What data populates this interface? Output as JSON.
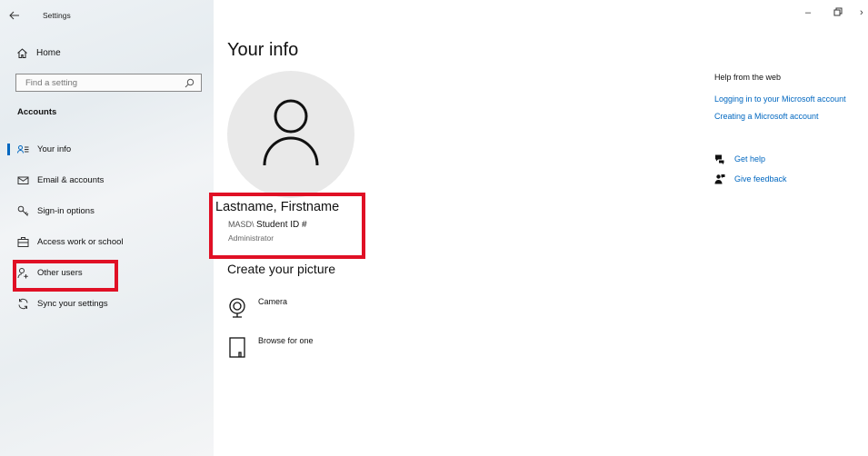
{
  "app": {
    "title": "Settings"
  },
  "window": {
    "minimize": "–",
    "restore": "⧉",
    "close": "›"
  },
  "sidebar": {
    "home_label": "Home",
    "search_placeholder": "Find a setting",
    "section_title": "Accounts",
    "items": [
      {
        "label": "Your info",
        "icon": "person-card-icon",
        "active": true
      },
      {
        "label": "Email & accounts",
        "icon": "mail-icon"
      },
      {
        "label": "Sign-in options",
        "icon": "key-icon"
      },
      {
        "label": "Access work or school",
        "icon": "briefcase-icon"
      },
      {
        "label": "Other users",
        "icon": "add-person-icon"
      },
      {
        "label": "Sync your settings",
        "icon": "sync-icon"
      }
    ]
  },
  "main": {
    "title": "Your info",
    "user": {
      "name": "Lastname, Firstname",
      "domain_prefix": "MASD\\",
      "student_id": "Student ID #",
      "role": "Administrator"
    },
    "create_picture": {
      "heading": "Create your picture",
      "options": [
        {
          "label": "Camera",
          "icon": "camera-icon"
        },
        {
          "label": "Browse for one",
          "icon": "browse-file-icon"
        }
      ]
    }
  },
  "help": {
    "title": "Help from the web",
    "links": [
      "Logging in to your Microsoft account",
      "Creating a Microsoft account"
    ],
    "get_help": "Get help",
    "give_feedback": "Give feedback"
  },
  "colors": {
    "accent": "#0067c0",
    "highlight": "#e01025"
  }
}
